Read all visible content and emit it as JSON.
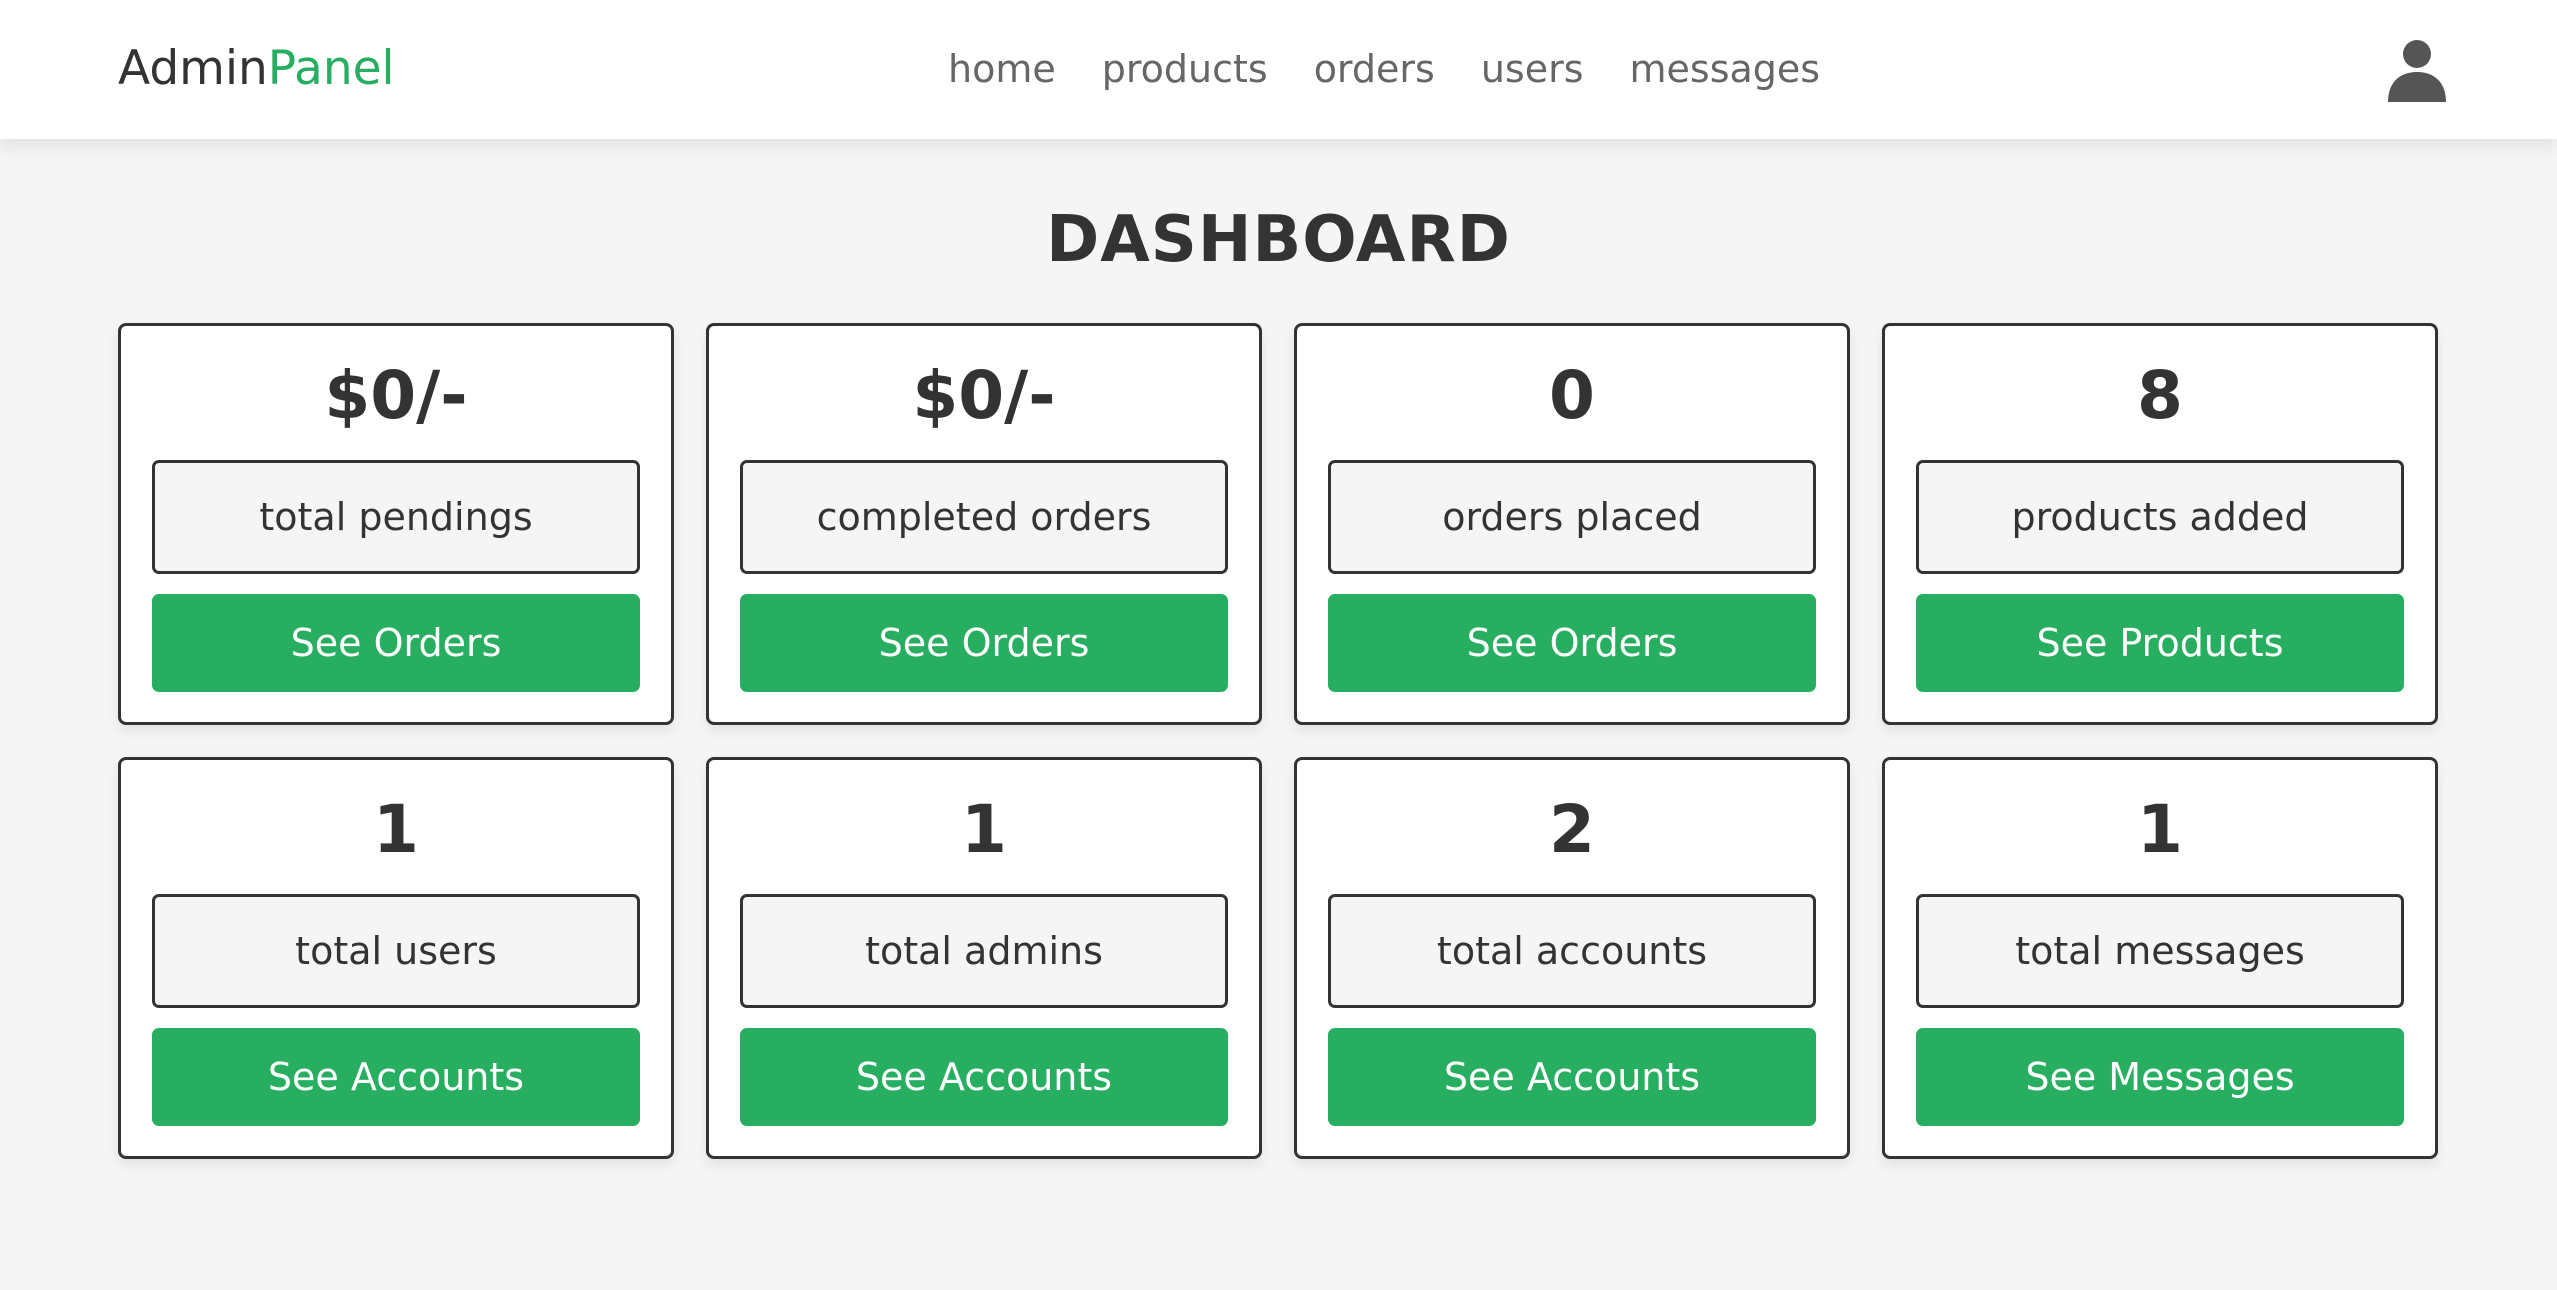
{
  "header": {
    "logo_main": "Admin",
    "logo_accent": "Panel",
    "nav": [
      "home",
      "products",
      "orders",
      "users",
      "messages"
    ],
    "user_icon": "user-icon"
  },
  "page_title": "DASHBOARD",
  "cards": [
    {
      "value": "$0/-",
      "label": "total pendings",
      "button": "See Orders"
    },
    {
      "value": "$0/-",
      "label": "completed orders",
      "button": "See Orders"
    },
    {
      "value": "0",
      "label": "orders placed",
      "button": "See Orders"
    },
    {
      "value": "8",
      "label": "products added",
      "button": "See Products"
    },
    {
      "value": "1",
      "label": "total users",
      "button": "See Accounts"
    },
    {
      "value": "1",
      "label": "total admins",
      "button": "See Accounts"
    },
    {
      "value": "2",
      "label": "total accounts",
      "button": "See Accounts"
    },
    {
      "value": "1",
      "label": "total messages",
      "button": "See Messages"
    }
  ],
  "colors": {
    "accent": "#27ae60",
    "text": "#333333",
    "background": "#f5f5f5"
  }
}
